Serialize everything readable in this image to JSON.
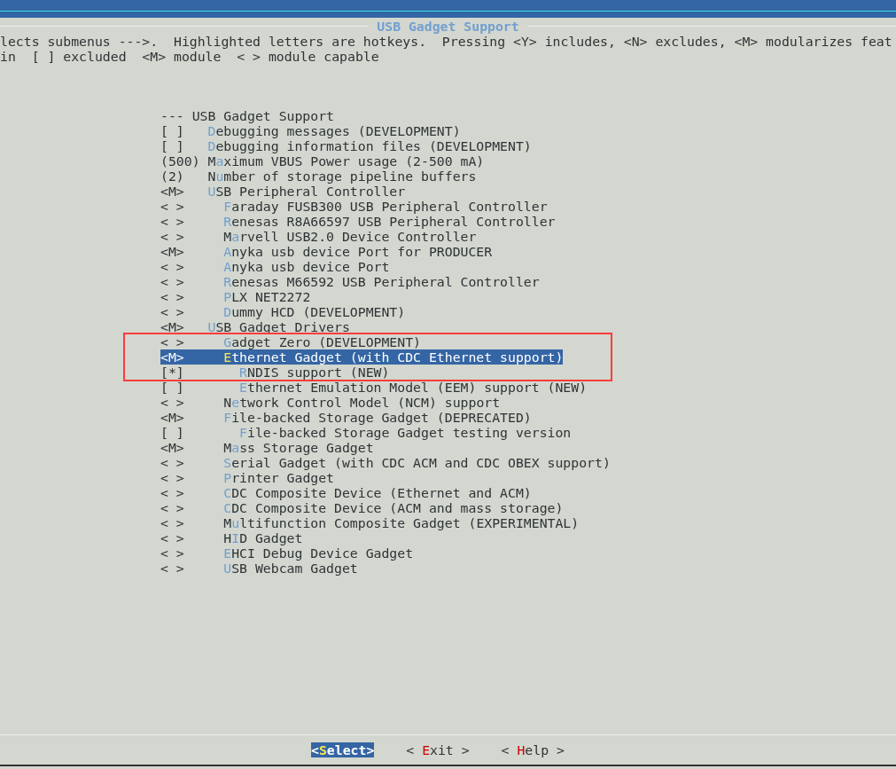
{
  "dialog": {
    "title": "USB Gadget Support"
  },
  "help_lines": [
    "lects submenus --->.  Highlighted letters are hotkeys.  Pressing <Y> includes, <N> excludes, <M> modularizes feat",
    "in  [ ] excluded  <M> module  < > module capable"
  ],
  "menu": {
    "heading": "--- USB Gadget Support",
    "items": [
      {
        "state": "[ ]",
        "hotkey": "D",
        "after": "ebugging messages (DEVELOPMENT)",
        "selected": false
      },
      {
        "state": "[ ]",
        "hotkey": "D",
        "after": "ebugging information files (DEVELOPMENT)",
        "selected": false
      },
      {
        "state": "(500)",
        "before": "M",
        "hotkey": "a",
        "after": "ximum VBUS Power usage (2-500 mA)",
        "selected": false
      },
      {
        "state": "(2)",
        "before": "N",
        "hotkey": "u",
        "after": "mber of storage pipeline buffers",
        "selected": false
      },
      {
        "state": "<M>",
        "hotkey": "U",
        "after": "SB Peripheral Controller",
        "selected": false,
        "children": [
          {
            "state": "< >",
            "hotkey": "F",
            "after": "araday FUSB300 USB Peripheral Controller",
            "selected": false
          },
          {
            "state": "< >",
            "hotkey": "R",
            "after": "enesas R8A66597 USB Peripheral Controller",
            "selected": false
          },
          {
            "state": "< >",
            "before": "M",
            "hotkey": "a",
            "after": "rvell USB2.0 Device Controller",
            "selected": false
          },
          {
            "state": "<M>",
            "hotkey": "A",
            "after": "nyka usb device Port for PRODUCER",
            "selected": false
          },
          {
            "state": "< >",
            "hotkey": "A",
            "after": "nyka usb device Port",
            "selected": false
          },
          {
            "state": "< >",
            "hotkey": "R",
            "after": "enesas M66592 USB Peripheral Controller",
            "selected": false
          },
          {
            "state": "< >",
            "hotkey": "P",
            "after": "LX NET2272",
            "selected": false
          },
          {
            "state": "< >",
            "hotkey": "D",
            "after": "ummy HCD (DEVELOPMENT)",
            "selected": false
          }
        ]
      },
      {
        "state": "<M>",
        "hotkey": "U",
        "after": "SB Gadget Drivers",
        "selected": false,
        "children": [
          {
            "state": "< >",
            "hotkey": "G",
            "after": "adget Zero (DEVELOPMENT)",
            "selected": false
          },
          {
            "state": "<M>",
            "hotkey": "E",
            "after": "thernet Gadget (with CDC Ethernet support)",
            "selected": true,
            "children": [
              {
                "state": "[*]",
                "hotkey": "R",
                "after": "NDIS support (NEW)",
                "selected": false
              },
              {
                "state": "[ ]",
                "hotkey": "E",
                "after": "thernet Emulation Model (EEM) support (NEW)",
                "selected": false
              }
            ]
          },
          {
            "state": "< >",
            "before": "N",
            "hotkey": "e",
            "after": "twork Control Model (NCM) support",
            "selected": false
          },
          {
            "state": "<M>",
            "hotkey": "F",
            "after": "ile-backed Storage Gadget (DEPRECATED)",
            "selected": false,
            "children": [
              {
                "state": "[ ]",
                "hotkey": "F",
                "after": "ile-backed Storage Gadget testing version",
                "selected": false
              }
            ]
          },
          {
            "state": "<M>",
            "before": "M",
            "hotkey": "a",
            "after": "ss Storage Gadget",
            "selected": false
          },
          {
            "state": "< >",
            "hotkey": "S",
            "after": "erial Gadget (with CDC ACM and CDC OBEX support)",
            "selected": false
          },
          {
            "state": "< >",
            "hotkey": "P",
            "after": "rinter Gadget",
            "selected": false
          },
          {
            "state": "< >",
            "hotkey": "C",
            "after": "DC Composite Device (Ethernet and ACM)",
            "selected": false
          },
          {
            "state": "< >",
            "hotkey": "C",
            "after": "DC Composite Device (ACM and mass storage)",
            "selected": false
          },
          {
            "state": "< >",
            "before": "M",
            "hotkey": "u",
            "after": "ltifunction Composite Gadget (EXPERIMENTAL)",
            "selected": false
          },
          {
            "state": "< >",
            "before": "H",
            "hotkey": "I",
            "after": "D Gadget",
            "selected": false
          },
          {
            "state": "< >",
            "hotkey": "E",
            "after": "HCI Debug Device Gadget",
            "selected": false
          },
          {
            "state": "< >",
            "hotkey": "U",
            "after": "SB Webcam Gadget",
            "selected": false
          }
        ]
      }
    ]
  },
  "buttons": [
    {
      "before": "<",
      "hotkey": "S",
      "after": "elect>",
      "selected": true
    },
    {
      "before": "< ",
      "hotkey": "E",
      "after": "xit >",
      "selected": false
    },
    {
      "before": "< ",
      "hotkey": "H",
      "after": "elp >",
      "selected": false
    }
  ]
}
